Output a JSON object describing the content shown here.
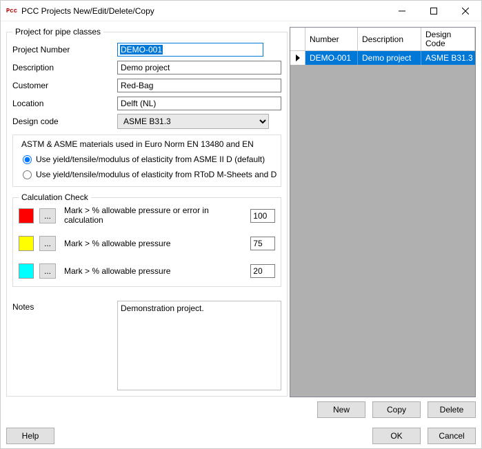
{
  "window": {
    "title": "PCC Projects New/Edit/Delete/Copy",
    "app_icon_text": "Pcc"
  },
  "groupbox": {
    "project_title": "Project for pipe classes",
    "calc_title": "Calculation Check"
  },
  "labels": {
    "project_number": "Project Number",
    "description": "Description",
    "customer": "Customer",
    "location": "Location",
    "design_code": "Design code",
    "notes": "Notes"
  },
  "fields": {
    "project_number": "DEMO-001",
    "description": "Demo project",
    "customer": "Red-Bag",
    "location": "Delft (NL)",
    "design_code": "ASME B31.3",
    "notes": "Demonstration project."
  },
  "materials_section": {
    "header": "ASTM & ASME materials used in Euro Norm EN 13480 and EN",
    "opt1": "Use yield/tensile/modulus of elasticity from ASME II D (default)",
    "opt2": "Use yield/tensile/modulus of elasticity from RToD M-Sheets and D"
  },
  "calc": {
    "ellipsis": "...",
    "row1_label": "Mark > % allowable pressure or error in calculation",
    "row1_value": "100",
    "row2_label": "Mark > % allowable pressure",
    "row2_value": "75",
    "row3_label": "Mark > % allowable pressure",
    "row3_value": "20"
  },
  "grid": {
    "headers": {
      "number": "Number",
      "description": "Description",
      "code": "Design Code"
    },
    "rows": [
      {
        "number": "DEMO-001",
        "description": "Demo project",
        "code": "ASME B31.3"
      }
    ]
  },
  "buttons": {
    "new": "New",
    "copy": "Copy",
    "delete": "Delete",
    "help": "Help",
    "ok": "OK",
    "cancel": "Cancel"
  }
}
